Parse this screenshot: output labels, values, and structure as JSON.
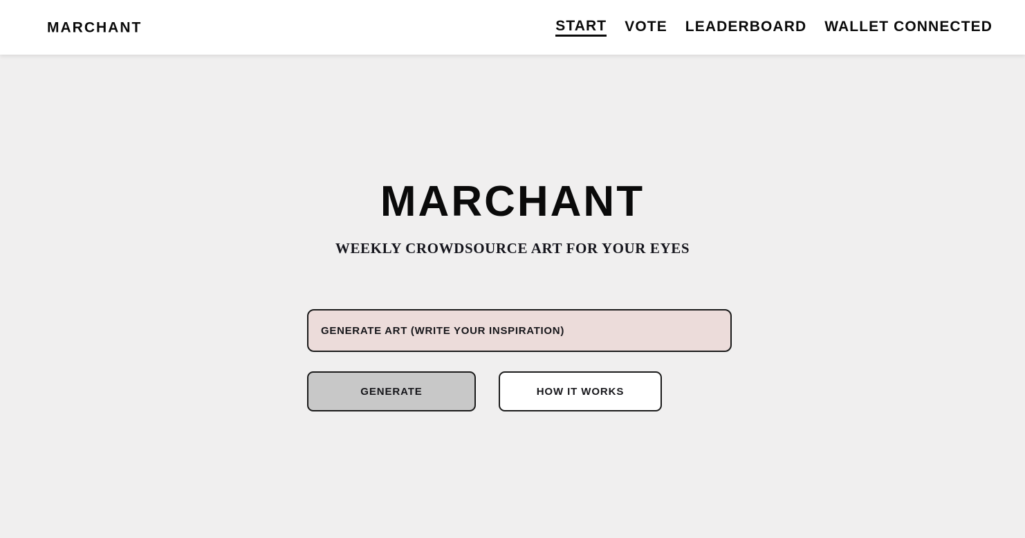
{
  "header": {
    "brand": "MARCHANT",
    "nav": [
      {
        "label": "START",
        "active": true
      },
      {
        "label": "VOTE",
        "active": false
      },
      {
        "label": "LEADERBOARD",
        "active": false
      },
      {
        "label": "WALLET CONNECTED",
        "active": false
      }
    ]
  },
  "hero": {
    "title": "MARCHANT",
    "subtitle": "WEEKLY CROWDSOURCE ART FOR YOUR EYES"
  },
  "form": {
    "prompt_value": "",
    "prompt_placeholder": "GENERATE ART (WRITE YOUR INSPIRATION)",
    "generate_label": "GENERATE",
    "how_it_works_label": "HOW IT WORKS"
  },
  "colors": {
    "page_background": "#f0efef",
    "header_background": "#ffffff",
    "text": "#0a0a0a",
    "input_background": "#ecdcda",
    "generate_background": "#c8c8c8",
    "how_background": "#ffffff",
    "border": "#1a1a1a"
  }
}
